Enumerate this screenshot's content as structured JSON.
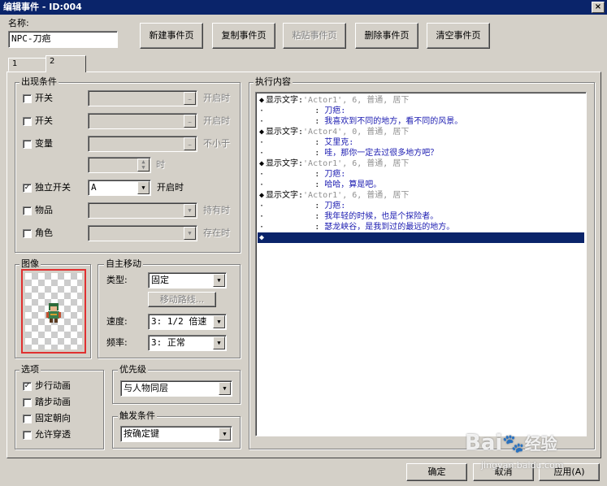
{
  "window": {
    "title": "编辑事件 - ID:004",
    "close": "×"
  },
  "name": {
    "label": "名称:",
    "value": "NPC-刀疤"
  },
  "toolbar": {
    "new_page": "新建事件页",
    "copy_page": "复制事件页",
    "paste_page": "粘贴事件页",
    "delete_page": "删除事件页",
    "clear_page": "清空事件页"
  },
  "tabs": [
    "1",
    "2"
  ],
  "conditions": {
    "title": "出现条件",
    "switch1": {
      "label": "开关",
      "checked": false,
      "suffix": "开启时"
    },
    "switch2": {
      "label": "开关",
      "checked": false,
      "suffix": "开启时"
    },
    "variable": {
      "label": "变量",
      "checked": false,
      "suffix": "不小于"
    },
    "variable_time_suffix": "时",
    "self_switch": {
      "label": "独立开关",
      "checked": true,
      "value": "A",
      "suffix": "开启时"
    },
    "item": {
      "label": "物品",
      "checked": false,
      "suffix": "持有时"
    },
    "actor": {
      "label": "角色",
      "checked": false,
      "suffix": "存在时"
    }
  },
  "graphic": {
    "title": "图像"
  },
  "autonomous": {
    "title": "自主移动",
    "type_label": "类型:",
    "type_value": "固定",
    "route_button": "移动路线...",
    "speed_label": "速度:",
    "speed_value": "3: 1/2 倍速",
    "freq_label": "频率:",
    "freq_value": "3: 正常"
  },
  "options": {
    "title": "选项",
    "items": [
      {
        "label": "步行动画",
        "checked": true
      },
      {
        "label": "踏步动画",
        "checked": false
      },
      {
        "label": "固定朝向",
        "checked": false
      },
      {
        "label": "允许穿透",
        "checked": false
      }
    ]
  },
  "priority": {
    "title": "优先级",
    "value": "与人物同层"
  },
  "trigger": {
    "title": "触发条件",
    "value": "按确定键"
  },
  "commands": {
    "title": "执行内容",
    "rows": [
      {
        "mark": "◆",
        "cmd": "显示文字:",
        "args": "'Actor1', 6, 普通, 居下",
        "text": ""
      },
      {
        "mark": "·",
        "cmd": "",
        "args": "",
        "text": "刀疤:"
      },
      {
        "mark": "·",
        "cmd": "",
        "args": "",
        "text": "我喜欢到不同的地方，看不同的风景。"
      },
      {
        "mark": "◆",
        "cmd": "显示文字:",
        "args": "'Actor4', 0, 普通, 居下",
        "text": ""
      },
      {
        "mark": "·",
        "cmd": "",
        "args": "",
        "text": "艾里克:"
      },
      {
        "mark": "·",
        "cmd": "",
        "args": "",
        "text": "哇，那你一定去过很多地方吧？"
      },
      {
        "mark": "◆",
        "cmd": "显示文字:",
        "args": "'Actor1', 6, 普通, 居下",
        "text": ""
      },
      {
        "mark": "·",
        "cmd": "",
        "args": "",
        "text": "刀疤:"
      },
      {
        "mark": "·",
        "cmd": "",
        "args": "",
        "text": "哈哈，算是吧。"
      },
      {
        "mark": "◆",
        "cmd": "显示文字:",
        "args": "'Actor1', 6, 普通, 居下",
        "text": ""
      },
      {
        "mark": "·",
        "cmd": "",
        "args": "",
        "text": "刀疤:"
      },
      {
        "mark": "·",
        "cmd": "",
        "args": "",
        "text": "我年轻的时候，也是个探险者。"
      },
      {
        "mark": "·",
        "cmd": "",
        "args": "",
        "text": "瑟龙峡谷，是我到过的最远的地方。"
      },
      {
        "mark": "◆",
        "cmd": "",
        "args": "",
        "text": "",
        "selected": true
      }
    ]
  },
  "footer": {
    "ok": "确定",
    "cancel": "取消",
    "apply": "应用(A)"
  },
  "watermark": {
    "brand": "Bai",
    "suffix": "经验",
    "url": "jingyan.baidu.com"
  },
  "colors": {
    "titlebar": "#0a246a",
    "face": "#d4d0c8",
    "selection": "#0a246a",
    "text_blue": "#1a1ab0",
    "text_gray": "#909090",
    "highlight_border": "#e03030"
  }
}
